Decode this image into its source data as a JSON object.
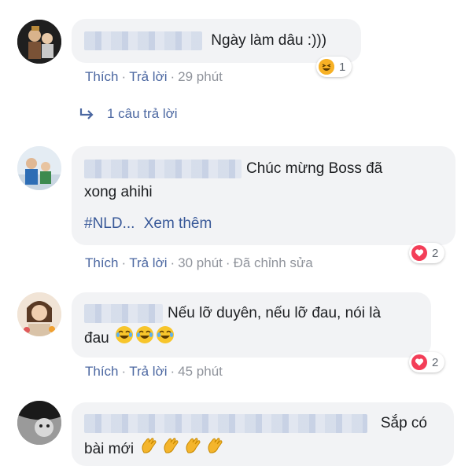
{
  "comments": [
    {
      "text": "Ngày làm dâu :)))",
      "actions": {
        "like": "Thích",
        "reply": "Trả lời",
        "time": "29 phút",
        "edited": ""
      },
      "reaction": {
        "icon": "haha-icon",
        "count": "1"
      },
      "replies_link": "1 câu trả lời"
    },
    {
      "text_line1": "Chúc mừng Boss đã",
      "text_line2": "xong ahihi",
      "hashtag": "#NLD...",
      "see_more": "Xem thêm",
      "actions": {
        "like": "Thích",
        "reply": "Trả lời",
        "time": "30 phút",
        "edited": "Đã chỉnh sửa"
      },
      "reaction": {
        "icon": "heart-icon",
        "count": "2"
      }
    },
    {
      "text_line1": "Nếu lỡ duyên, nếu lỡ đau, nói là",
      "text_line2": "đau",
      "emojis": [
        "tears-of-joy-icon",
        "tears-of-joy-icon",
        "tears-of-joy-icon"
      ],
      "actions": {
        "like": "Thích",
        "reply": "Trả lời",
        "time": "45 phút",
        "edited": ""
      },
      "reaction": {
        "icon": "heart-icon",
        "count": "2"
      }
    },
    {
      "text_line1": "Sắp có",
      "text_line2": "bài mới",
      "emojis": [
        "clapping-hands-icon",
        "clapping-hands-icon",
        "clapping-hands-icon",
        "clapping-hands-icon"
      ]
    }
  ],
  "colors": {
    "bubble": "#f2f3f5",
    "link": "#4b67a1",
    "meta": "#90949c",
    "heart": "#f33e58",
    "haha": "#f7b125"
  }
}
